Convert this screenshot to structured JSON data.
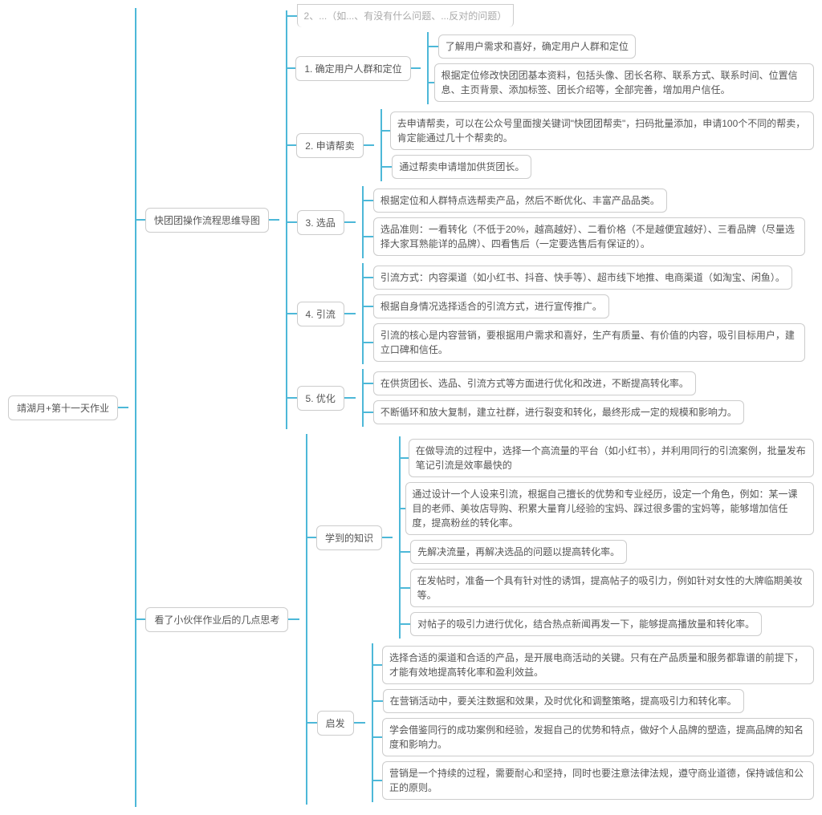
{
  "root": "靖湖月+第十一天作业",
  "branch1": {
    "title": "快团团操作流程思维导图",
    "top_cut": "2、...（如...、有没有什么问题、...反对的问题）",
    "items": [
      {
        "label": "1. 确定用户人群和定位",
        "leaves": [
          "了解用户需求和喜好，确定用户人群和定位",
          "根据定位修改快团团基本资料，包括头像、团长名称、联系方式、联系时间、位置信息、主页背景、添加标签、团长介绍等，全部完善，增加用户信任。"
        ]
      },
      {
        "label": "2. 申请帮卖",
        "leaves": [
          "去申请帮卖，可以在公众号里面搜关键词\"快团团帮卖\"，扫码批量添加，申请100个不同的帮卖，肯定能通过几十个帮卖的。",
          "通过帮卖申请增加供货团长。"
        ]
      },
      {
        "label": "3. 选品",
        "leaves": [
          "根据定位和人群特点选帮卖产品，然后不断优化、丰富产品品类。",
          "选品准则：一看转化（不低于20%，越高越好）、二看价格（不是越便宜越好）、三看品牌（尽量选择大家耳熟能详的品牌）、四看售后（一定要选售后有保证的）。"
        ]
      },
      {
        "label": "4. 引流",
        "leaves": [
          "引流方式：内容渠道（如小红书、抖音、快手等）、超市线下地推、电商渠道（如淘宝、闲鱼）。",
          "根据自身情况选择适合的引流方式，进行宣传推广。",
          "引流的核心是内容营销，要根据用户需求和喜好，生产有质量、有价值的内容，吸引目标用户，建立口碑和信任。"
        ]
      },
      {
        "label": "5. 优化",
        "leaves": [
          "在供货团长、选品、引流方式等方面进行优化和改进，不断提高转化率。",
          "不断循环和放大复制，建立社群，进行裂变和转化，最终形成一定的规模和影响力。"
        ]
      }
    ]
  },
  "branch2": {
    "title": "看了小伙伴作业后的几点思考",
    "items": [
      {
        "label": "学到的知识",
        "leaves": [
          "在做导流的过程中，选择一个高流量的平台（如小红书），并利用同行的引流案例，批量发布笔记引流是效率最快的",
          "通过设计一个人设来引流，根据自己擅长的优势和专业经历，设定一个角色，例如：某一课目的老师、美妆店导购、积累大量育儿经验的宝妈、踩过很多雷的宝妈等，能够增加信任度，提高粉丝的转化率。",
          "先解决流量，再解决选品的问题以提高转化率。",
          "在发帖时，准备一个具有针对性的诱饵，提高帖子的吸引力，例如针对女性的大牌临期美妆等。",
          "对帖子的吸引力进行优化，结合热点新闻再发一下，能够提高播放量和转化率。"
        ]
      },
      {
        "label": "启发",
        "leaves": [
          "选择合适的渠道和合适的产品，是开展电商活动的关键。只有在产品质量和服务都靠谱的前提下，才能有效地提高转化率和盈利效益。",
          "在营销活动中，要关注数据和效果，及时优化和调整策略，提高吸引力和转化率。",
          "学会借鉴同行的成功案例和经验，发掘自己的优势和特点，做好个人品牌的塑造，提高品牌的知名度和影响力。",
          "营销是一个持续的过程，需要耐心和坚持，同时也要注意法律法规，遵守商业道德，保持诚信和公正的原则。"
        ]
      }
    ]
  }
}
